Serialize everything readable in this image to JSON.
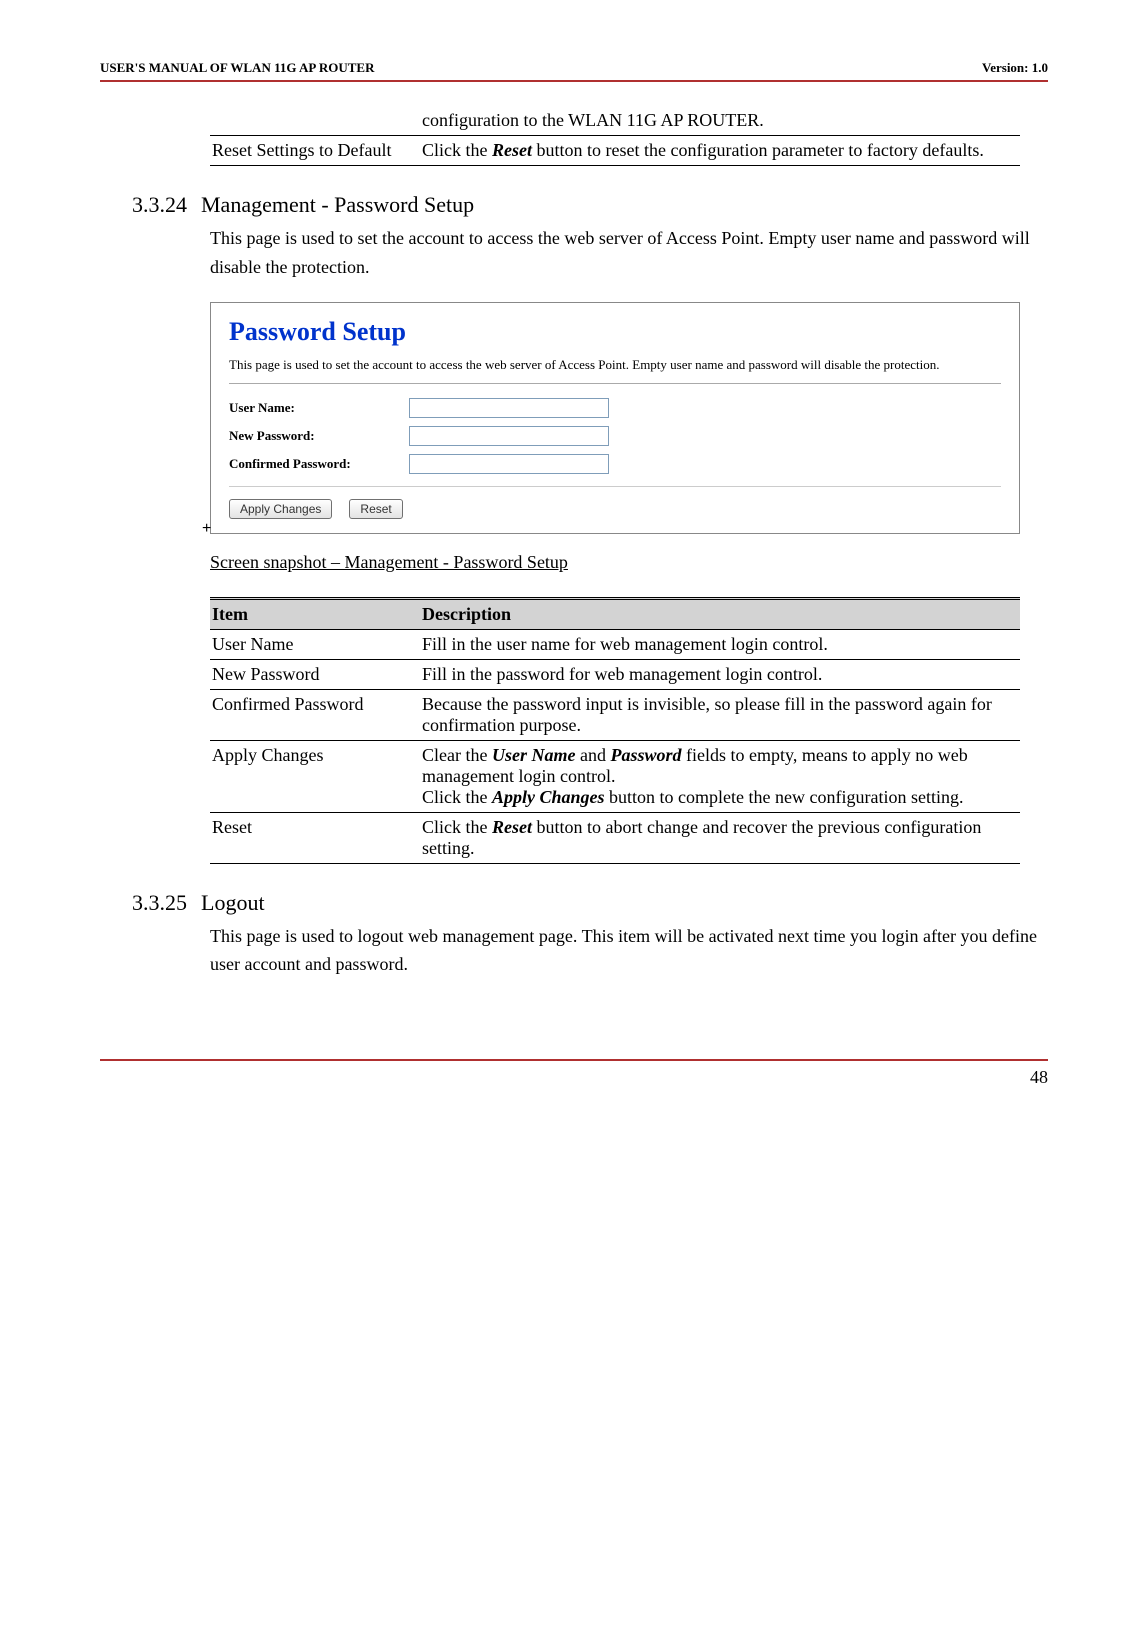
{
  "header_left": "USER'S MANUAL OF WLAN 11G AP ROUTER",
  "header_right": "Version: 1.0",
  "table1": {
    "rows": [
      {
        "item": "",
        "desc": "configuration to the WLAN 11G AP ROUTER."
      },
      {
        "item": "Reset Settings to Default",
        "desc_prefix": "Click the ",
        "desc_bold": "Reset",
        "desc_suffix": " button to reset the configuration parameter to factory defaults."
      }
    ]
  },
  "heading1_num": "3.3.24",
  "heading1_text": "Management - Password Setup",
  "para1": "This page is used to set the account to access the web server of Access Point. Empty user name and password will disable the protection.",
  "screenshot": {
    "title": "Password Setup",
    "desc": "This page is used to set the account to access the web server of Access Point. Empty user name and password will disable the protection.",
    "user_name_label": "User Name:",
    "new_password_label": "New Password:",
    "confirmed_password_label": "Confirmed Password:",
    "apply_label": "Apply Changes",
    "reset_label": "Reset"
  },
  "plus": "+",
  "caption1": "Screen snapshot – Management - Password Setup",
  "table2": {
    "header_item": "Item",
    "header_desc": "Description",
    "rows": [
      {
        "item": "User Name",
        "desc": "Fill in the user name for web management login control."
      },
      {
        "item": "New Password",
        "desc": "Fill in the password for web management login control."
      },
      {
        "item": "Confirmed Password",
        "desc": "Because the password input is invisible, so please fill in the password again for confirmation purpose."
      }
    ],
    "apply_item": "Apply Changes",
    "apply_p1a": "Clear the ",
    "apply_p1b": "User Name",
    "apply_p1c": " and ",
    "apply_p1d": "Password",
    "apply_p1e": " fields to empty, means to apply no web management login control.",
    "apply_p2a": "Click the ",
    "apply_p2b": "Apply Changes",
    "apply_p2c": " button to complete the new configuration setting.",
    "reset_item": "Reset",
    "reset_a": "Click the ",
    "reset_b": "Reset",
    "reset_c": " button to abort change and recover the previous configuration setting."
  },
  "heading2_num": "3.3.25",
  "heading2_text": "Logout",
  "para2": "This page is used to logout web management page. This item will be activated next time you login after you define user account and password.",
  "page_number": "48"
}
